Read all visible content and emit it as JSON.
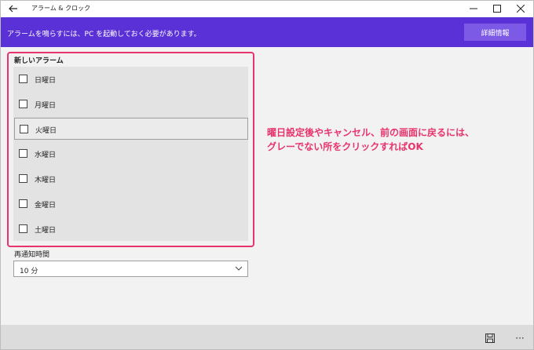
{
  "window": {
    "title": "アラーム & クロック"
  },
  "banner": {
    "message": "アラームを鳴らすには、PC を起動しておく必要があります。",
    "details_label": "詳細情報"
  },
  "alarm": {
    "name": "新しいアラーム",
    "days": [
      {
        "label": "日曜日",
        "checked": false
      },
      {
        "label": "月曜日",
        "checked": false
      },
      {
        "label": "火曜日",
        "checked": false
      },
      {
        "label": "水曜日",
        "checked": false
      },
      {
        "label": "木曜日",
        "checked": false
      },
      {
        "label": "金曜日",
        "checked": false
      },
      {
        "label": "土曜日",
        "checked": false
      }
    ]
  },
  "snooze": {
    "label": "再通知時間",
    "value": "10 分"
  },
  "annotation": {
    "line1": "曜日設定後やキャンセル、前の画面に戻るには、",
    "line2": "グレーでない所をクリックすればOK"
  },
  "colors": {
    "accent": "#5a31d6",
    "annotation": "#e8336c"
  }
}
